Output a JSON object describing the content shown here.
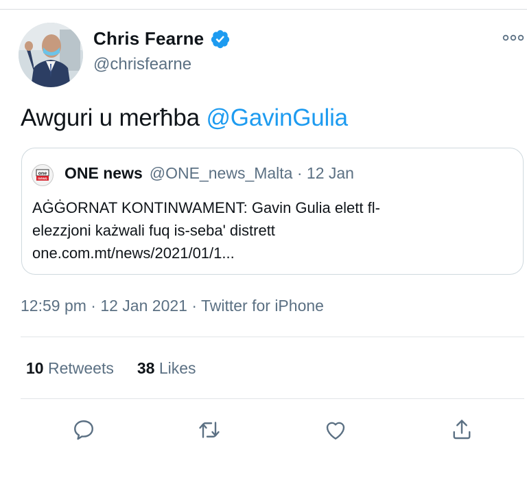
{
  "author": {
    "name": "Chris Fearne",
    "handle": "@chrisfearne"
  },
  "tweet": {
    "text": "Awguri u merħba ",
    "mention": "@GavinGulia"
  },
  "quoted_tweet": {
    "logo_text": "one news",
    "name": "ONE news",
    "meta": "@ONE_news_Malta · 12 Jan",
    "line1": "AĠĠORNAT KONTINWAMENT: Gavin Gulia elett fl-",
    "line2": "elezzjoni każwali fuq is-seba' distrett",
    "line3": "one.com.mt/news/2021/01/1..."
  },
  "timestamp": "12:59 pm · 12 Jan 2021 · Twitter for iPhone",
  "stats": {
    "retweets_count": "10",
    "retweets_label": "Retweets",
    "likes_count": "38",
    "likes_label": "Likes"
  },
  "colors": {
    "accent": "#1d9bf0",
    "secondary_text": "#5b7083",
    "divider": "#e1e5e8"
  },
  "icons": [
    "verified-badge-icon",
    "more-options-icon",
    "reply-icon",
    "retweet-icon",
    "like-icon",
    "share-icon"
  ]
}
